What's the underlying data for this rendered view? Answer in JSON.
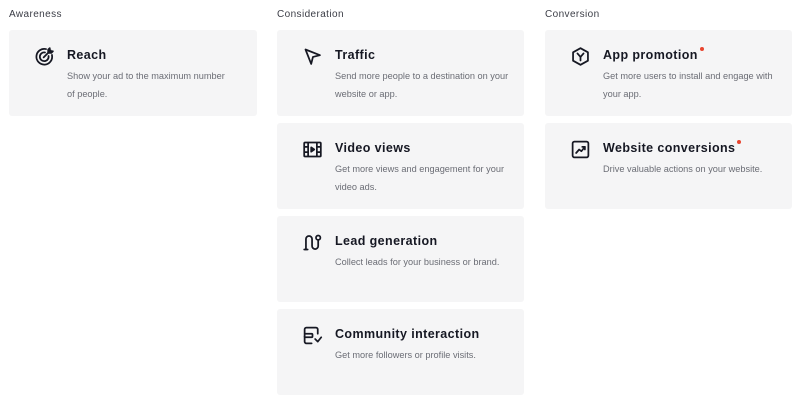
{
  "columns": [
    {
      "header": "Awareness",
      "cards": [
        {
          "icon": "target-icon",
          "title": "Reach",
          "desc": "Show your ad to the maximum number of people.",
          "badge": false
        }
      ]
    },
    {
      "header": "Consideration",
      "cards": [
        {
          "icon": "cursor-arrow-icon",
          "title": "Traffic",
          "desc": "Send more people to a destination on your website or app.",
          "badge": false
        },
        {
          "icon": "video-film-icon",
          "title": "Video views",
          "desc": "Get more views and engagement for your video ads.",
          "badge": false
        },
        {
          "icon": "magnet-icon",
          "title": "Lead generation",
          "desc": "Collect leads for your business or brand.",
          "badge": false
        },
        {
          "icon": "community-icon",
          "title": "Community interaction",
          "desc": "Get more followers or profile visits.",
          "badge": false
        }
      ]
    },
    {
      "header": "Conversion",
      "cards": [
        {
          "icon": "app-hexagon-icon",
          "title": "App promotion",
          "desc": "Get more users to install and engage with your app.",
          "badge": true
        },
        {
          "icon": "trend-chart-icon",
          "title": "Website conversions",
          "desc": "Drive valuable actions on your website.",
          "badge": true
        }
      ]
    }
  ],
  "colors": {
    "card_background": "#f5f5f6",
    "badge_dot": "#e8452f",
    "description_text": "#6b6d75"
  }
}
